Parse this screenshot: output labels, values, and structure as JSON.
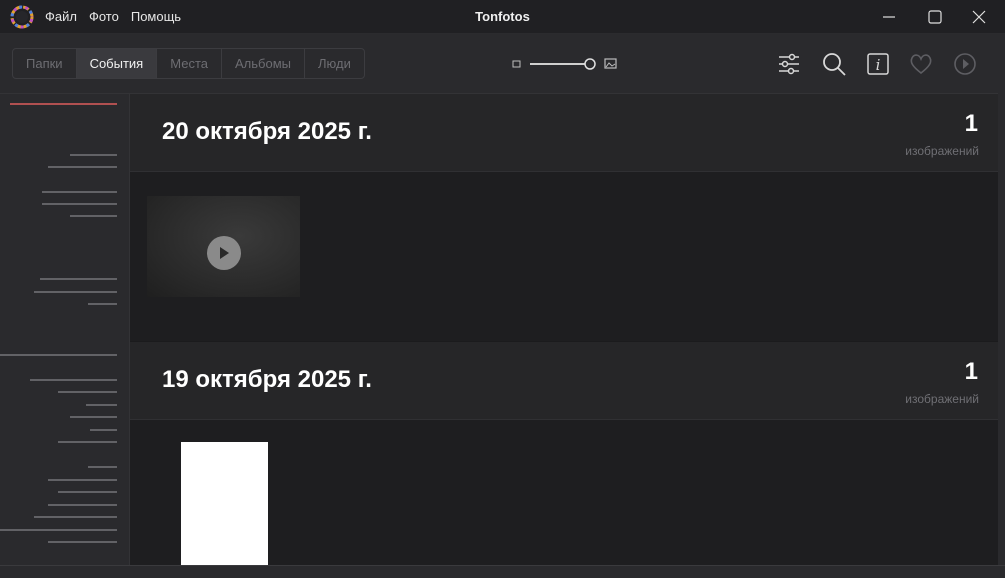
{
  "window": {
    "title": "Tonfotos",
    "menu": [
      "Файл",
      "Фото",
      "Помощь"
    ]
  },
  "toolbar": {
    "tabs": [
      {
        "label": "Папки",
        "active": false
      },
      {
        "label": "События",
        "active": true
      },
      {
        "label": "Места",
        "active": false
      },
      {
        "label": "Альбомы",
        "active": false
      },
      {
        "label": "Люди",
        "active": false
      }
    ]
  },
  "events": [
    {
      "date": "20 октября 2025 г.",
      "count": "1",
      "count_label": "изображений",
      "media": "video"
    },
    {
      "date": "19 октября 2025 г.",
      "count": "1",
      "count_label": "изображений",
      "media": "image"
    }
  ],
  "colors": {
    "background": "#1b1b1d",
    "panel": "#2a2a2d",
    "timeline_accent": "#b05050"
  }
}
